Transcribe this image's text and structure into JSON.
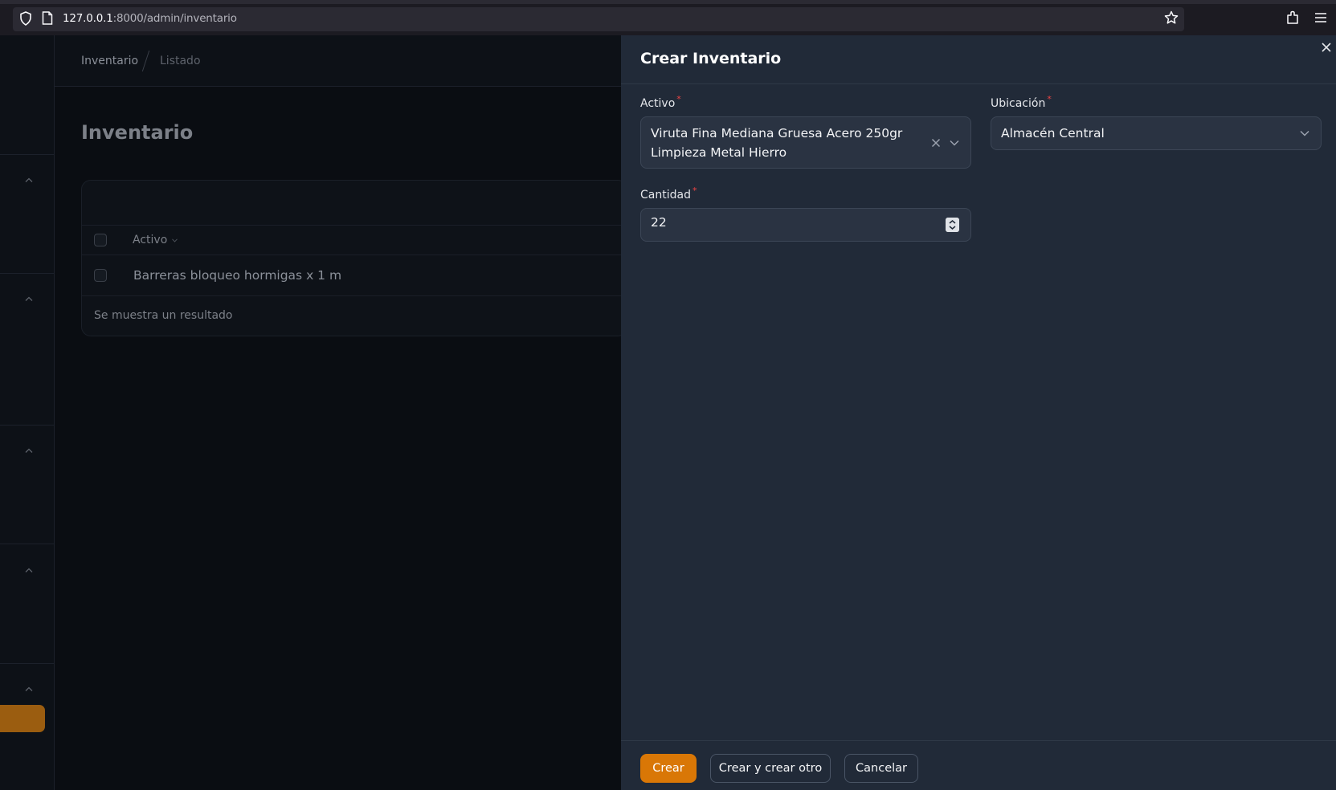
{
  "browser": {
    "url_host": "127.0.0.1",
    "url_rest": ":8000/admin/inventario"
  },
  "breadcrumb": {
    "items": [
      "Inventario",
      "Listado"
    ]
  },
  "page": {
    "title": "Inventario"
  },
  "table": {
    "column": "Activo",
    "rows": [
      "Barreras bloqueo hormigas x 1 m"
    ],
    "footer": "Se muestra un resultado"
  },
  "modal": {
    "title": "Crear Inventario",
    "fields": {
      "activo": {
        "label": "Activo",
        "value_line1": "Viruta Fina Mediana Gruesa Acero 250gr",
        "value_line2": "Limpieza Metal Hierro"
      },
      "ubicacion": {
        "label": "Ubicación",
        "value": "Almacén Central"
      },
      "cantidad": {
        "label": "Cantidad",
        "value": "22"
      }
    },
    "required_mark": "*",
    "buttons": {
      "create": "Crear",
      "create_another": "Crear y crear otro",
      "cancel": "Cancelar"
    }
  },
  "colors": {
    "accent": "#d97706",
    "panel": "#212a38",
    "required": "#ef4444"
  },
  "icons": [
    "shield-icon",
    "page-icon",
    "star-icon",
    "extensions-icon",
    "menu-icon",
    "close-icon",
    "chevron-down-icon",
    "clear-icon",
    "spinner-icon"
  ]
}
